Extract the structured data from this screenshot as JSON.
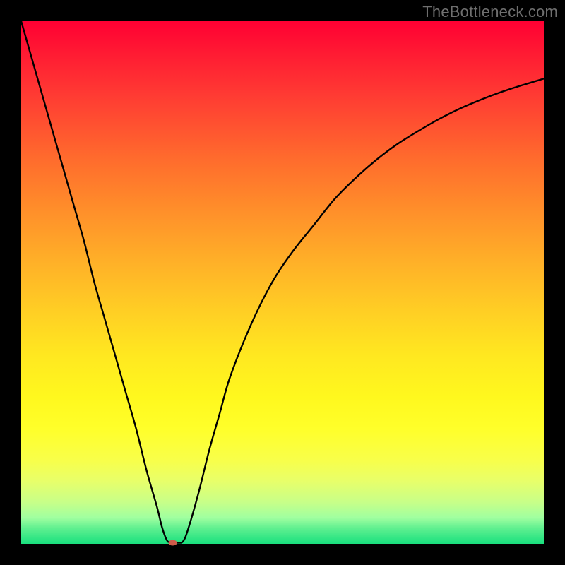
{
  "watermark": "TheBottleneck.com",
  "chart_data": {
    "type": "line",
    "title": "",
    "xlabel": "",
    "ylabel": "",
    "xlim": [
      0,
      100
    ],
    "ylim": [
      0,
      100
    ],
    "grid": false,
    "legend": false,
    "background_gradient": {
      "top": "#ff0033",
      "mid": "#ffd024",
      "bottom": "#19e07e"
    },
    "series": [
      {
        "name": "bottleneck-curve",
        "color": "#000000",
        "x": [
          0,
          2,
          4,
          6,
          8,
          10,
          12,
          14,
          16,
          18,
          20,
          22,
          24,
          26,
          27,
          28,
          29,
          30,
          31,
          32,
          34,
          36,
          38,
          40,
          44,
          48,
          52,
          56,
          60,
          64,
          68,
          72,
          76,
          80,
          84,
          88,
          92,
          96,
          100
        ],
        "y": [
          100,
          93,
          86,
          79,
          72,
          65,
          58,
          50,
          43,
          36,
          29,
          22,
          14,
          7,
          3,
          0.5,
          0.3,
          0.2,
          0.5,
          3,
          10,
          18,
          25,
          32,
          42,
          50,
          56,
          61,
          66,
          70,
          73.5,
          76.5,
          79,
          81.3,
          83.3,
          85,
          86.5,
          87.8,
          89
        ]
      }
    ],
    "marker": {
      "name": "min-point",
      "x": 29,
      "y": 0.2,
      "color": "#cf5b4a",
      "rx": 6,
      "ry": 4
    }
  }
}
